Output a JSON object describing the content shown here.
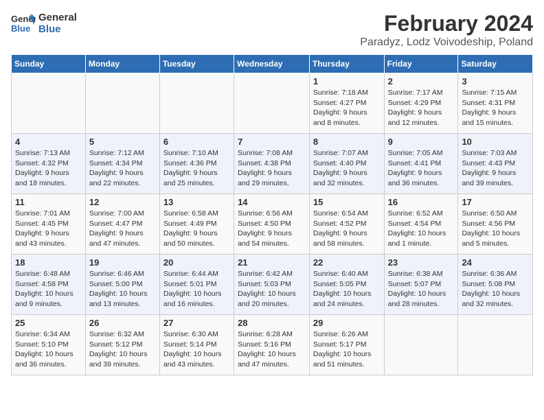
{
  "header": {
    "logo_line1": "General",
    "logo_line2": "Blue",
    "title": "February 2024",
    "subtitle": "Paradyz, Lodz Voivodeship, Poland"
  },
  "days_of_week": [
    "Sunday",
    "Monday",
    "Tuesday",
    "Wednesday",
    "Thursday",
    "Friday",
    "Saturday"
  ],
  "weeks": [
    [
      {
        "day": "",
        "detail": ""
      },
      {
        "day": "",
        "detail": ""
      },
      {
        "day": "",
        "detail": ""
      },
      {
        "day": "",
        "detail": ""
      },
      {
        "day": "1",
        "detail": "Sunrise: 7:18 AM\nSunset: 4:27 PM\nDaylight: 9 hours\nand 8 minutes."
      },
      {
        "day": "2",
        "detail": "Sunrise: 7:17 AM\nSunset: 4:29 PM\nDaylight: 9 hours\nand 12 minutes."
      },
      {
        "day": "3",
        "detail": "Sunrise: 7:15 AM\nSunset: 4:31 PM\nDaylight: 9 hours\nand 15 minutes."
      }
    ],
    [
      {
        "day": "4",
        "detail": "Sunrise: 7:13 AM\nSunset: 4:32 PM\nDaylight: 9 hours\nand 18 minutes."
      },
      {
        "day": "5",
        "detail": "Sunrise: 7:12 AM\nSunset: 4:34 PM\nDaylight: 9 hours\nand 22 minutes."
      },
      {
        "day": "6",
        "detail": "Sunrise: 7:10 AM\nSunset: 4:36 PM\nDaylight: 9 hours\nand 25 minutes."
      },
      {
        "day": "7",
        "detail": "Sunrise: 7:08 AM\nSunset: 4:38 PM\nDaylight: 9 hours\nand 29 minutes."
      },
      {
        "day": "8",
        "detail": "Sunrise: 7:07 AM\nSunset: 4:40 PM\nDaylight: 9 hours\nand 32 minutes."
      },
      {
        "day": "9",
        "detail": "Sunrise: 7:05 AM\nSunset: 4:41 PM\nDaylight: 9 hours\nand 36 minutes."
      },
      {
        "day": "10",
        "detail": "Sunrise: 7:03 AM\nSunset: 4:43 PM\nDaylight: 9 hours\nand 39 minutes."
      }
    ],
    [
      {
        "day": "11",
        "detail": "Sunrise: 7:01 AM\nSunset: 4:45 PM\nDaylight: 9 hours\nand 43 minutes."
      },
      {
        "day": "12",
        "detail": "Sunrise: 7:00 AM\nSunset: 4:47 PM\nDaylight: 9 hours\nand 47 minutes."
      },
      {
        "day": "13",
        "detail": "Sunrise: 6:58 AM\nSunset: 4:49 PM\nDaylight: 9 hours\nand 50 minutes."
      },
      {
        "day": "14",
        "detail": "Sunrise: 6:56 AM\nSunset: 4:50 PM\nDaylight: 9 hours\nand 54 minutes."
      },
      {
        "day": "15",
        "detail": "Sunrise: 6:54 AM\nSunset: 4:52 PM\nDaylight: 9 hours\nand 58 minutes."
      },
      {
        "day": "16",
        "detail": "Sunrise: 6:52 AM\nSunset: 4:54 PM\nDaylight: 10 hours\nand 1 minute."
      },
      {
        "day": "17",
        "detail": "Sunrise: 6:50 AM\nSunset: 4:56 PM\nDaylight: 10 hours\nand 5 minutes."
      }
    ],
    [
      {
        "day": "18",
        "detail": "Sunrise: 6:48 AM\nSunset: 4:58 PM\nDaylight: 10 hours\nand 9 minutes."
      },
      {
        "day": "19",
        "detail": "Sunrise: 6:46 AM\nSunset: 5:00 PM\nDaylight: 10 hours\nand 13 minutes."
      },
      {
        "day": "20",
        "detail": "Sunrise: 6:44 AM\nSunset: 5:01 PM\nDaylight: 10 hours\nand 16 minutes."
      },
      {
        "day": "21",
        "detail": "Sunrise: 6:42 AM\nSunset: 5:03 PM\nDaylight: 10 hours\nand 20 minutes."
      },
      {
        "day": "22",
        "detail": "Sunrise: 6:40 AM\nSunset: 5:05 PM\nDaylight: 10 hours\nand 24 minutes."
      },
      {
        "day": "23",
        "detail": "Sunrise: 6:38 AM\nSunset: 5:07 PM\nDaylight: 10 hours\nand 28 minutes."
      },
      {
        "day": "24",
        "detail": "Sunrise: 6:36 AM\nSunset: 5:08 PM\nDaylight: 10 hours\nand 32 minutes."
      }
    ],
    [
      {
        "day": "25",
        "detail": "Sunrise: 6:34 AM\nSunset: 5:10 PM\nDaylight: 10 hours\nand 36 minutes."
      },
      {
        "day": "26",
        "detail": "Sunrise: 6:32 AM\nSunset: 5:12 PM\nDaylight: 10 hours\nand 39 minutes."
      },
      {
        "day": "27",
        "detail": "Sunrise: 6:30 AM\nSunset: 5:14 PM\nDaylight: 10 hours\nand 43 minutes."
      },
      {
        "day": "28",
        "detail": "Sunrise: 6:28 AM\nSunset: 5:16 PM\nDaylight: 10 hours\nand 47 minutes."
      },
      {
        "day": "29",
        "detail": "Sunrise: 6:26 AM\nSunset: 5:17 PM\nDaylight: 10 hours\nand 51 minutes."
      },
      {
        "day": "",
        "detail": ""
      },
      {
        "day": "",
        "detail": ""
      }
    ]
  ]
}
